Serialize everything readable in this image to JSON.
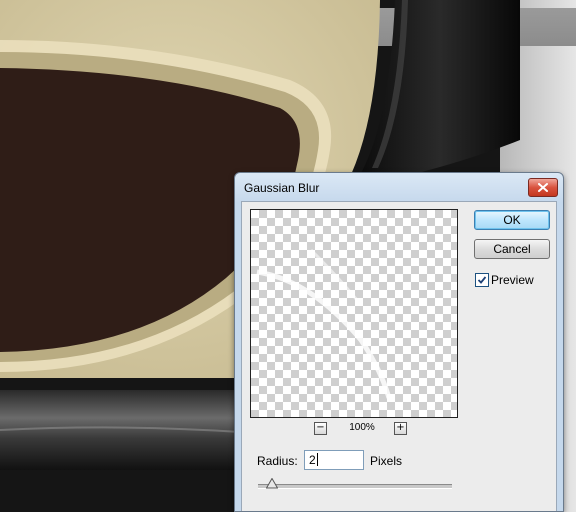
{
  "dialog": {
    "title": "Gaussian Blur",
    "ok_label": "OK",
    "cancel_label": "Cancel",
    "preview_label": "Preview",
    "preview_checked": true,
    "zoom_minus": "−",
    "zoom_plus": "+",
    "zoom_value": "100%",
    "radius_label": "Radius:",
    "radius_value": "2",
    "units_label": "Pixels",
    "radius_slider_fraction": 0.01
  },
  "colors": {
    "canvas_parchment": "#d6cba6",
    "canvas_dark_brown": "#2f1d17",
    "canvas_frame_black": "#151515",
    "title_bar": "#c5d8ec",
    "close_button": "#d9533f",
    "ok_button_accent": "#6fc3ee"
  },
  "icons": {
    "close": "close-x-icon",
    "checkbox": "checkmark-icon",
    "slider": "slider-triangle-icon"
  }
}
